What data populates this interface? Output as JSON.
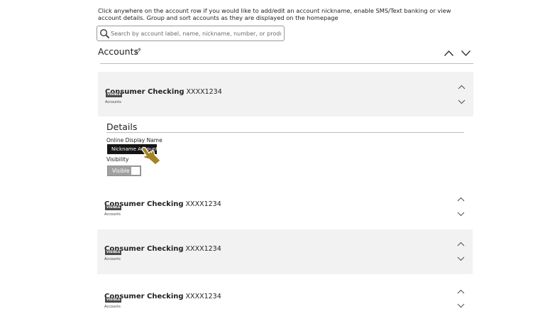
{
  "intro": {
    "text": "Click anywhere on the account row if you would like to add/edit an account nickname, enable SMS/Text banking or view account details. Group and sort accounts as they are displayed on the homepage"
  },
  "search": {
    "placeholder": "Search by account label, name, nickname, number, or product type",
    "icon": "search-icon"
  },
  "accounts_section": {
    "title": "Accounts",
    "edit_icon": "pencil-icon",
    "sort_up_icon": "chevron-up-icon",
    "sort_down_icon": "chevron-down-icon"
  },
  "account_rows": [
    {
      "name": "Consumer Checking",
      "number": "XXXX1234",
      "badge": "VISIBLE",
      "group": "Accounts"
    },
    {
      "name": "Consumer Checking",
      "number": "XXXX1234",
      "badge": "VISIBLE",
      "group": "Accounts"
    },
    {
      "name": "Consumer Checking",
      "number": "XXXX1234",
      "badge": "VISIBLE",
      "group": "Accounts"
    },
    {
      "name": "Consumer Checking",
      "number": "XXXX1234",
      "badge": "VISIBLE",
      "group": "Accounts"
    }
  ],
  "details": {
    "title": "Details",
    "online_display_label": "Online Display Name",
    "nickname_value": "Nickname Account",
    "visibility_label": "Visibility",
    "visibility_value": "Visible"
  },
  "colors": {
    "card_bg": "#f2f2f2",
    "badge_bg": "#4a4a4a",
    "field_bg": "#151515",
    "cursor": "#a78324"
  }
}
